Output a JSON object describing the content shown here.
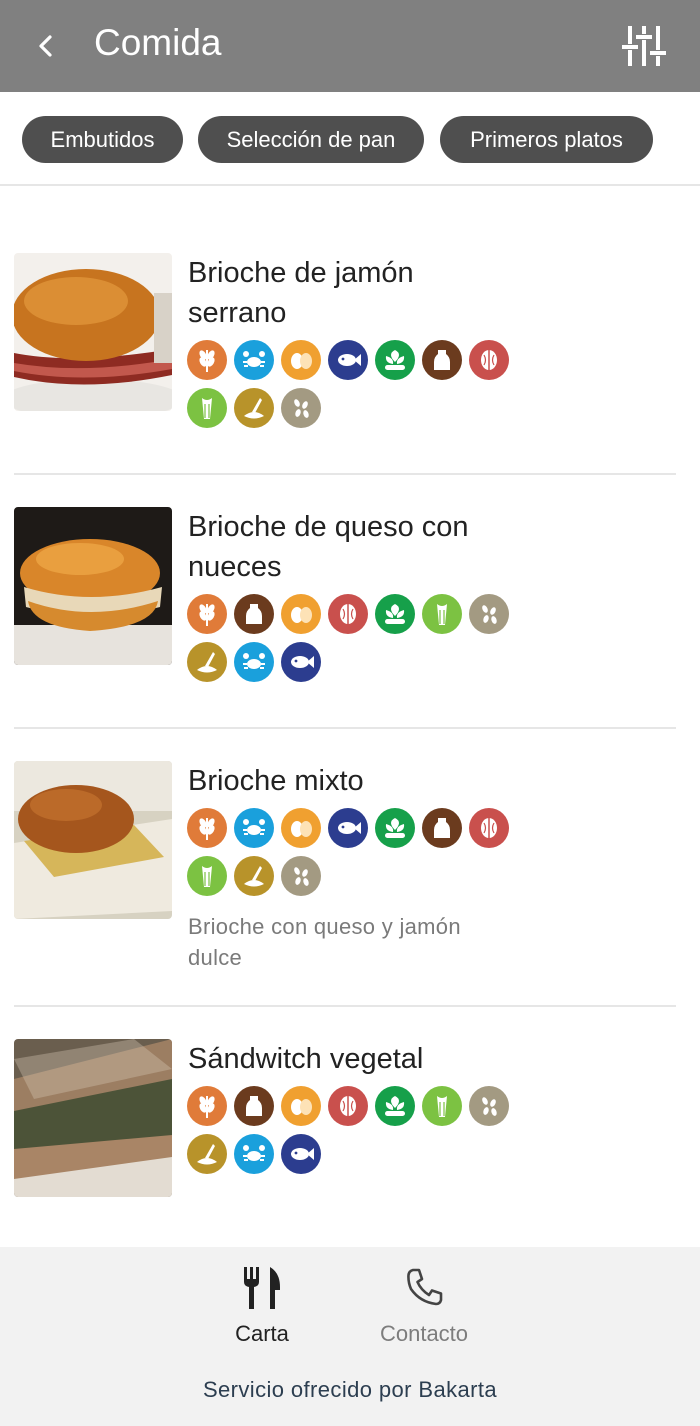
{
  "header": {
    "title": "Comida",
    "back_icon": "chevron-left-icon",
    "filter_icon": "sliders-icon"
  },
  "categories": [
    {
      "label": "Embutidos"
    },
    {
      "label": "Selección de pan"
    },
    {
      "label": "Primeros platos"
    }
  ],
  "allergen_colors": {
    "gluten": "#e07b39",
    "crustaceans": "#1aa0dc",
    "eggs": "#f0a030",
    "fish": "#2c3d8f",
    "soy": "#16a04a",
    "milk": "#6b3b1e",
    "nuts": "#c9504d",
    "celery": "#7cc242",
    "mustard": "#b8932a",
    "sesame": "#a39a82"
  },
  "items": [
    {
      "name": "Brioche de jamón serrano",
      "description": "",
      "allergens": [
        "gluten-icon",
        "crustacean-icon",
        "egg-icon",
        "fish-icon",
        "soy-icon",
        "milk-icon",
        "nut-icon",
        "celery-icon",
        "mustard-icon",
        "sesame-icon"
      ]
    },
    {
      "name": "Brioche de queso con nueces",
      "description": "",
      "allergens": [
        "gluten-icon",
        "milk-icon",
        "egg-icon",
        "nut-icon",
        "soy-icon",
        "celery-icon",
        "sesame-icon",
        "mustard-icon",
        "crustacean-icon",
        "fish-icon"
      ]
    },
    {
      "name": "Brioche mixto",
      "description": "Brioche con queso y jamón dulce",
      "allergens": [
        "gluten-icon",
        "crustacean-icon",
        "egg-icon",
        "fish-icon",
        "soy-icon",
        "milk-icon",
        "nut-icon",
        "celery-icon",
        "mustard-icon",
        "sesame-icon"
      ]
    },
    {
      "name": "Sándwitch vegetal",
      "description": "",
      "allergens": [
        "gluten-icon",
        "milk-icon",
        "egg-icon",
        "nut-icon",
        "soy-icon",
        "celery-icon",
        "sesame-icon",
        "mustard-icon",
        "crustacean-icon",
        "fish-icon"
      ]
    }
  ],
  "bottom_nav": {
    "items": [
      {
        "label": "Carta",
        "icon": "fork-knife-icon"
      },
      {
        "label": "Contacto",
        "icon": "phone-icon"
      }
    ],
    "credit": "Servicio ofrecido por Bakarta"
  }
}
